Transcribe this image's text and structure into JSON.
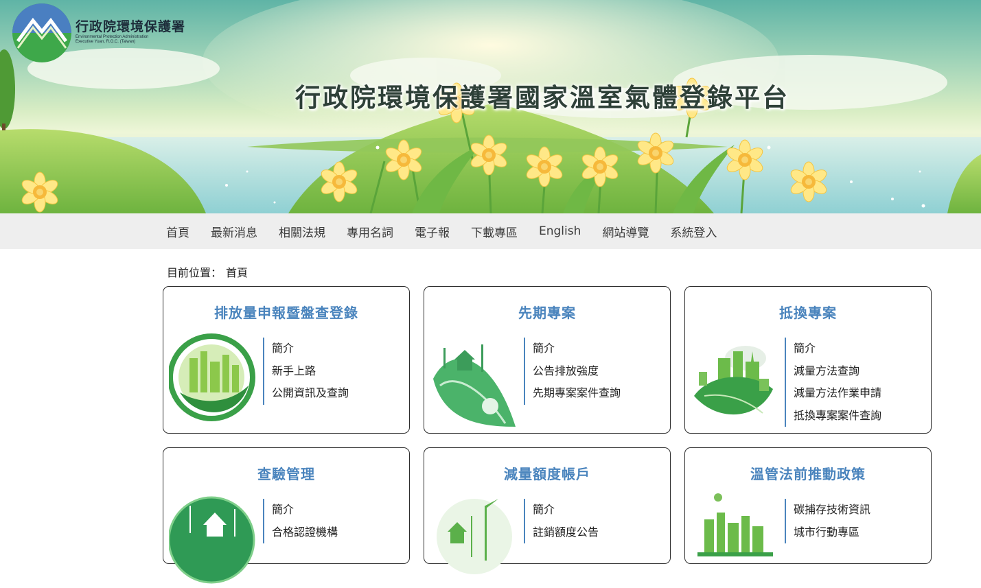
{
  "header": {
    "logo_cn": "行政院環境保護署",
    "logo_en_line1": "Environmental Protection Administration",
    "logo_en_line2": "Executive Yuan, R.O.C. (Taiwan)",
    "site_title": "行政院環境保護署國家溫室氣體登錄平台"
  },
  "nav": {
    "items": [
      "首頁",
      "最新消息",
      "相關法規",
      "專用名詞",
      "電子報",
      "下載專區",
      "English",
      "網站導覽",
      "系統登入"
    ]
  },
  "breadcrumb": {
    "label": "目前位置：",
    "current": "首頁"
  },
  "cards": [
    {
      "title": "排放量申報暨盤查登錄",
      "links": [
        "簡介",
        "新手上路",
        "公開資訊及查詢"
      ]
    },
    {
      "title": "先期專案",
      "links": [
        "簡介",
        "公告排放強度",
        "先期專案案件查詢"
      ]
    },
    {
      "title": "抵換專案",
      "links": [
        "簡介",
        "減量方法查詢",
        "減量方法作業申請",
        "抵換專案案件查詢"
      ]
    },
    {
      "title": "查驗管理",
      "links": [
        "簡介",
        "合格認證機構"
      ]
    },
    {
      "title": "減量額度帳戶",
      "links": [
        "簡介",
        "註銷額度公告"
      ]
    },
    {
      "title": "溫管法前推動政策",
      "links": [
        "碳捕存技術資訊",
        "城市行動專區"
      ]
    }
  ],
  "colors": {
    "accent": "#4a84bd",
    "nav_bg": "#eeeeee",
    "card_border": "#2d2d2d"
  }
}
